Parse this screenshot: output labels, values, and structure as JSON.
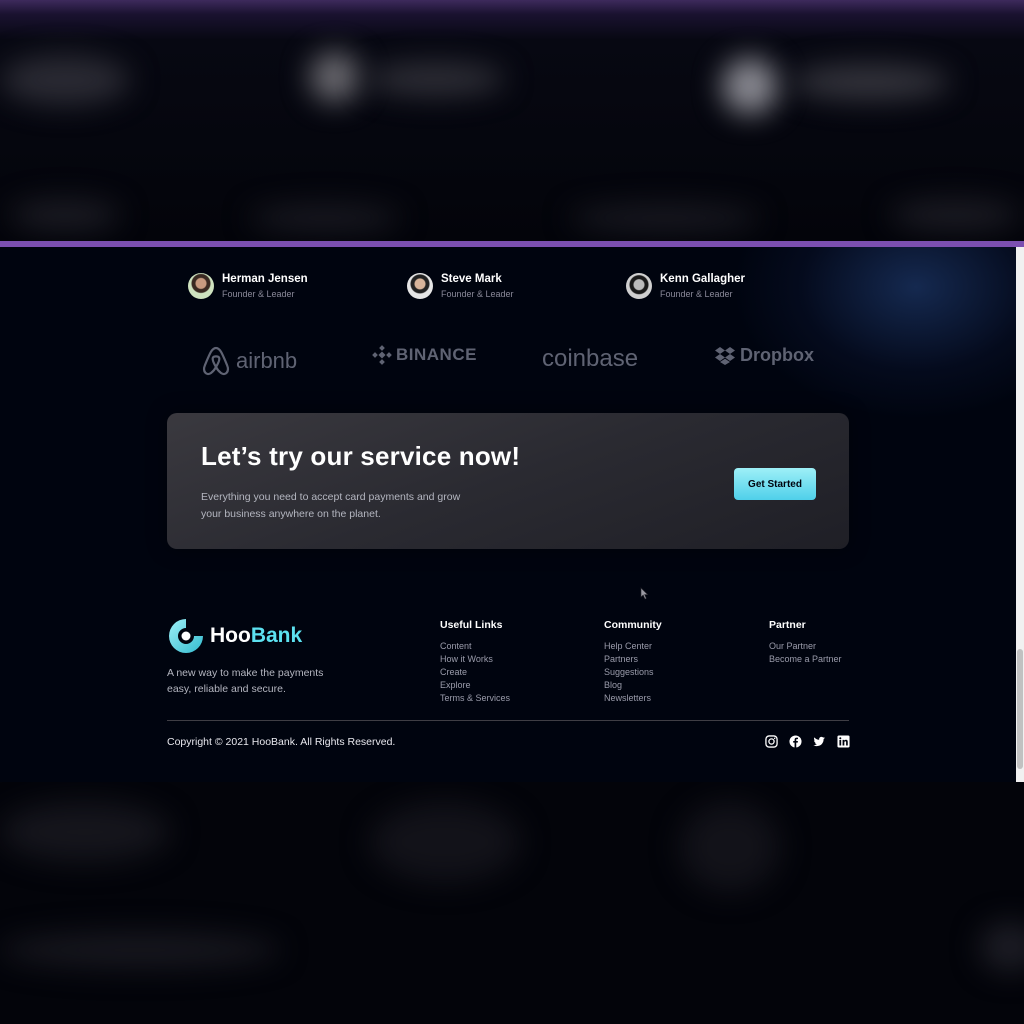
{
  "authors": [
    {
      "name": "Herman Jensen",
      "role": "Founder & Leader"
    },
    {
      "name": "Steve Mark",
      "role": "Founder & Leader"
    },
    {
      "name": "Kenn Gallagher",
      "role": "Founder & Leader"
    }
  ],
  "clients": [
    {
      "name": "airbnb",
      "icon": "airbnb-icon"
    },
    {
      "name": "BINANCE",
      "icon": "binance-icon"
    },
    {
      "name": "coinbase",
      "icon": ""
    },
    {
      "name": "Dropbox",
      "icon": "dropbox-icon"
    }
  ],
  "cta": {
    "title": "Let’s try our service now!",
    "description": "Everything you need to accept card payments and grow your business anywhere on the planet.",
    "button_label": "Get Started"
  },
  "footer": {
    "brand_first": "Hoo",
    "brand_second": "Bank",
    "tagline": "A new way to make the payments easy, reliable and secure.",
    "columns": [
      {
        "title": "Useful Links",
        "links": [
          "Content",
          "How it Works",
          "Create",
          "Explore",
          "Terms & Services"
        ]
      },
      {
        "title": "Community",
        "links": [
          "Help Center",
          "Partners",
          "Suggestions",
          "Blog",
          "Newsletters"
        ]
      },
      {
        "title": "Partner",
        "links": [
          "Our Partner",
          "Become a Partner"
        ]
      }
    ],
    "copyright": "Copyright © 2021 HooBank. All Rights Reserved.",
    "socials": [
      "instagram-icon",
      "facebook-icon",
      "twitter-icon",
      "linkedin-icon"
    ]
  },
  "colors": {
    "background": "#00040f",
    "accent": "#5ce1f0",
    "frame_border": "#7b4fb0"
  }
}
